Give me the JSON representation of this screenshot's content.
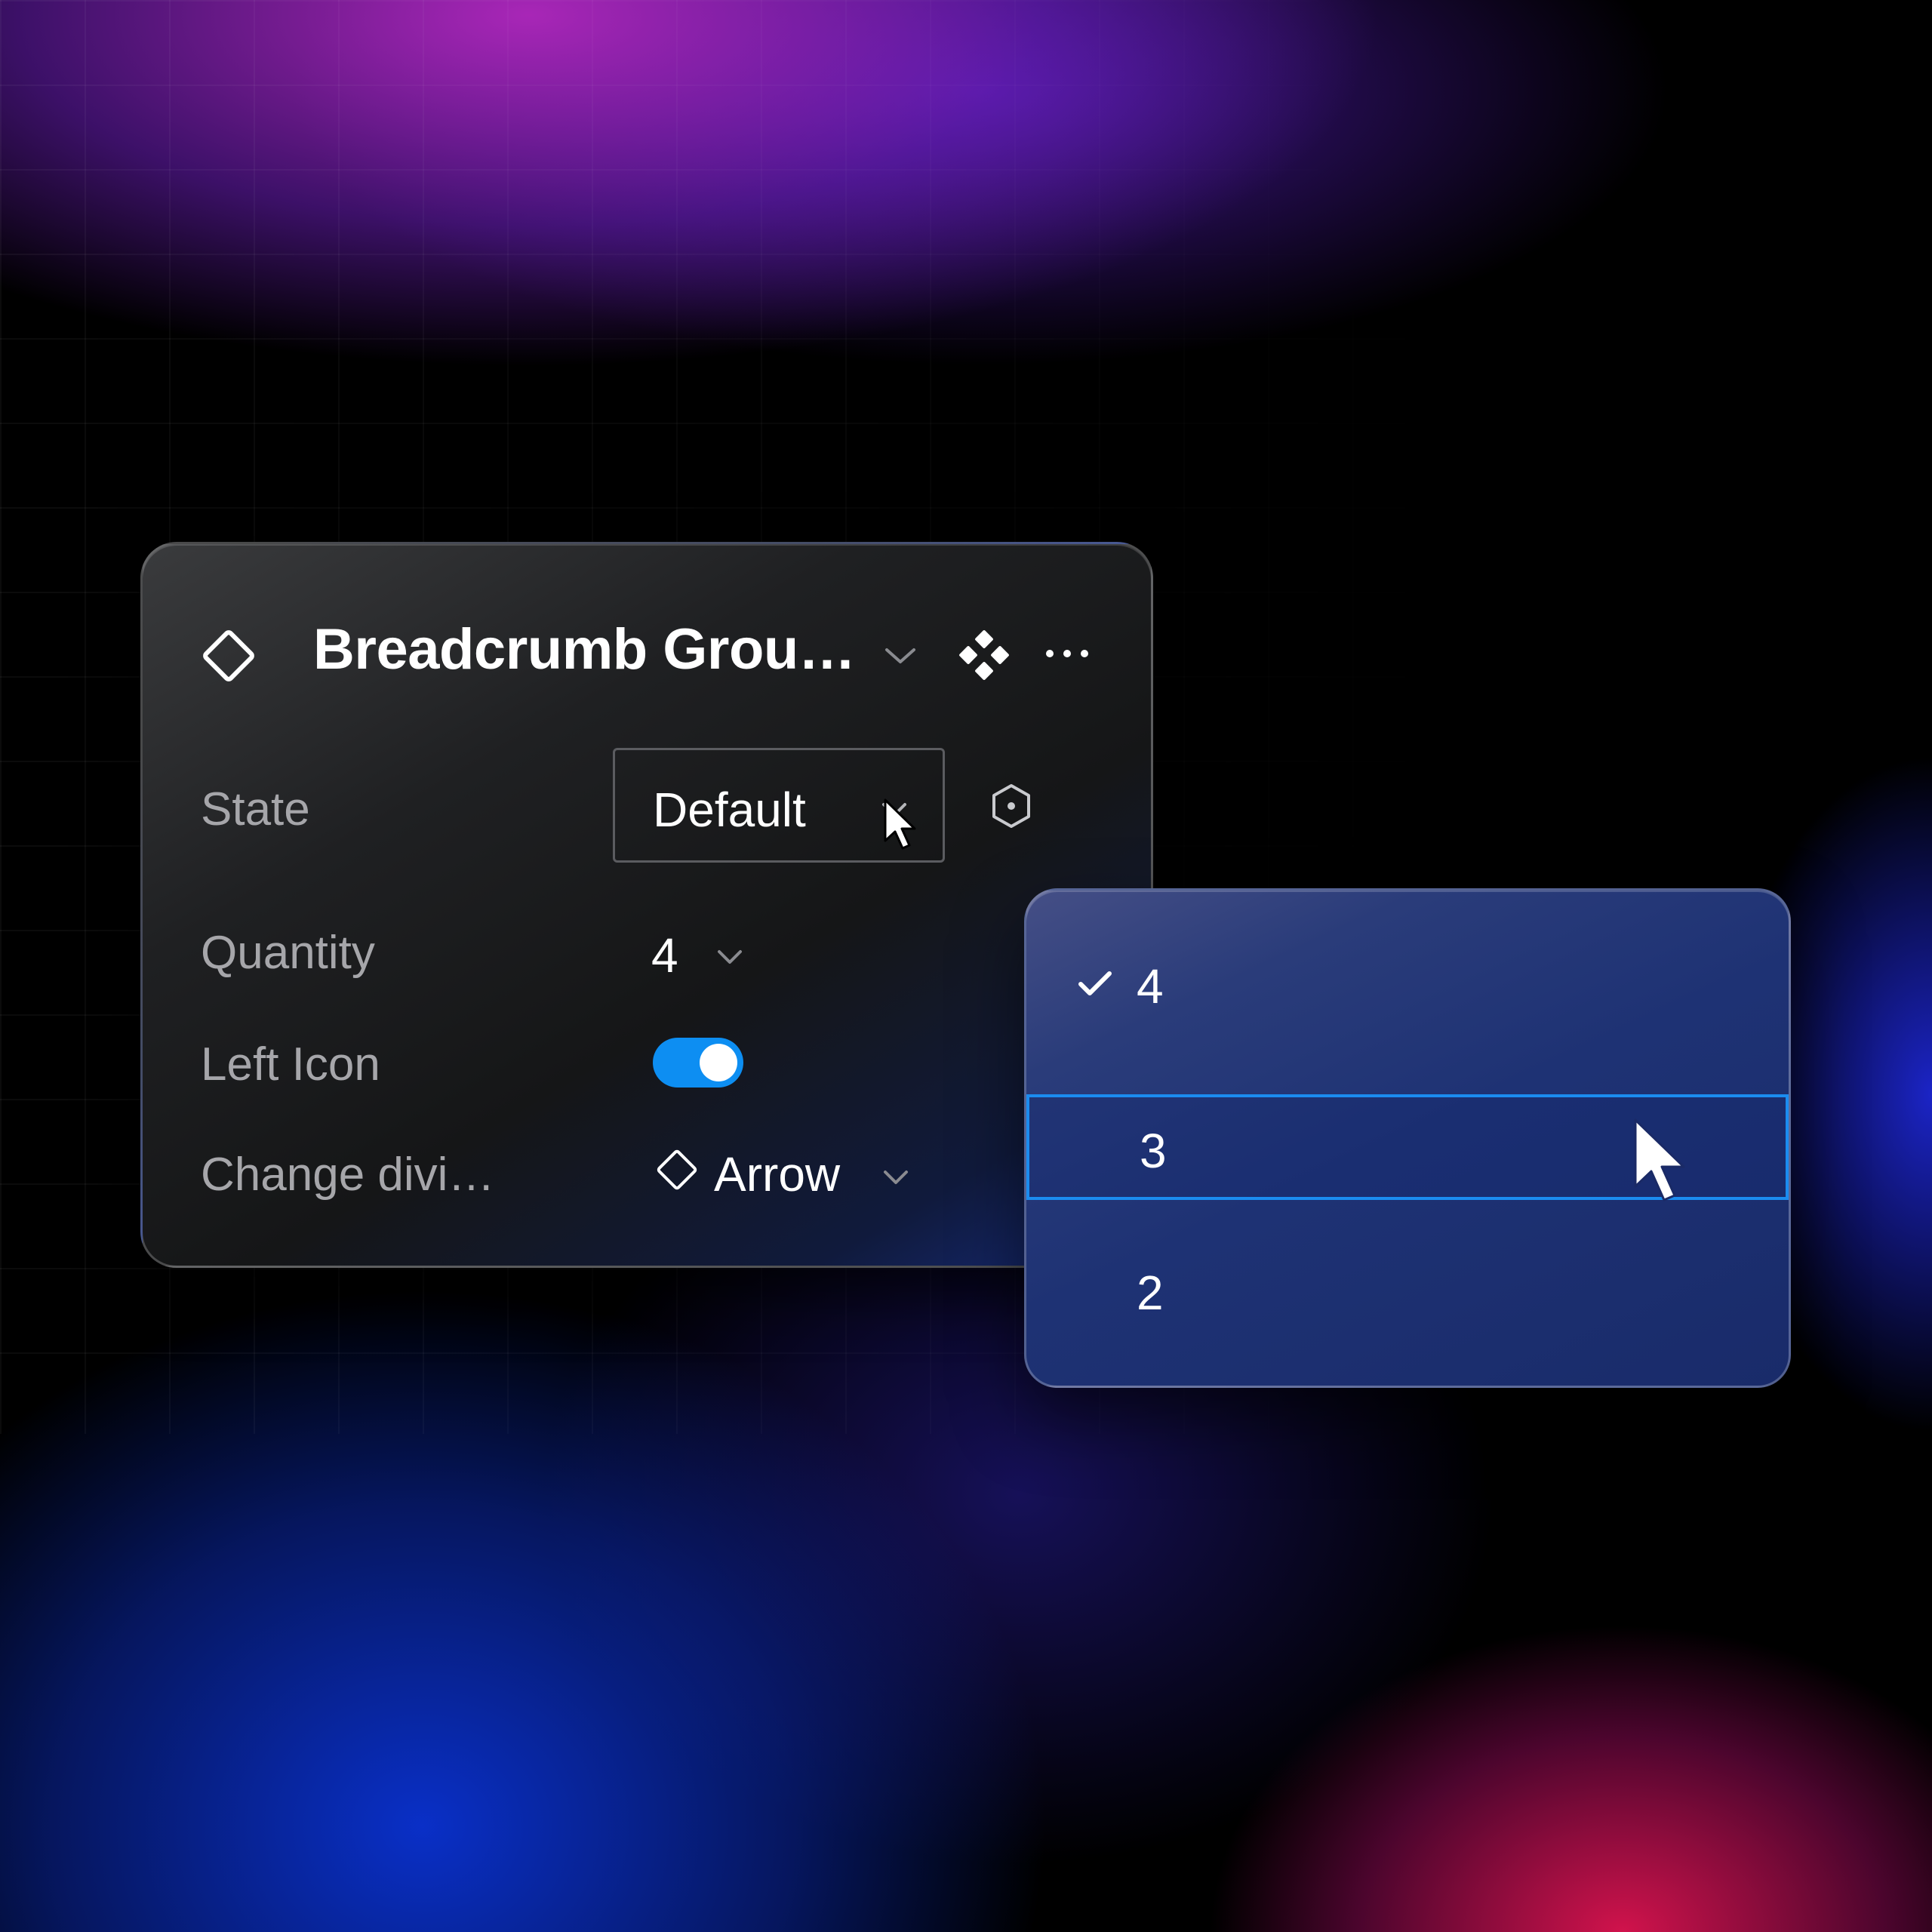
{
  "panel": {
    "title": "Breadcrumb Grou…",
    "properties": {
      "state": {
        "label": "State",
        "value": "Default"
      },
      "quantity": {
        "label": "Quantity",
        "value": "4"
      },
      "left_icon": {
        "label": "Left Icon",
        "enabled": true
      },
      "divider": {
        "label": "Change divi…",
        "value": "Arrow"
      }
    }
  },
  "dropdown": {
    "options": [
      {
        "label": "4",
        "checked": true,
        "highlighted": false
      },
      {
        "label": "3",
        "checked": false,
        "highlighted": true
      },
      {
        "label": "2",
        "checked": false,
        "highlighted": false
      }
    ]
  },
  "colors": {
    "accent": "#0d8ef2",
    "highlight_border": "#1b8cf0"
  },
  "icons": {
    "header": "diamond-outline-icon",
    "component": "component-icon",
    "more": "more-horizontal-icon",
    "variable": "hexagon-variable-icon",
    "checkmark": "check-icon",
    "cursor": "mouse-cursor-icon"
  }
}
